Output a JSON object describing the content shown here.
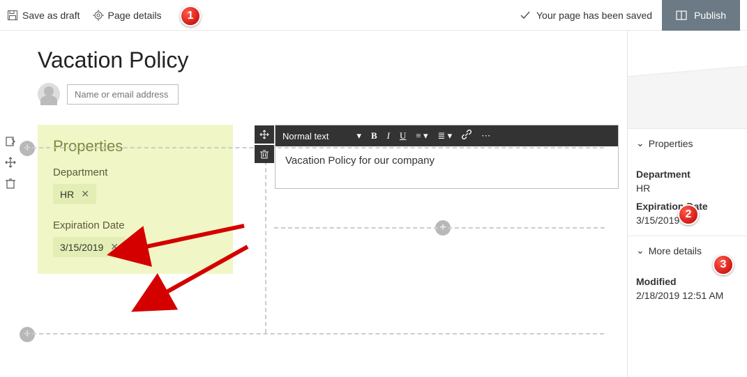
{
  "topbar": {
    "save_draft": "Save as draft",
    "page_details": "Page details",
    "saved_msg": "Your page has been saved",
    "publish": "Publish"
  },
  "page": {
    "title": "Vacation Policy",
    "name_placeholder": "Name or email address"
  },
  "editor": {
    "style_label": "Normal text",
    "body": "Vacation Policy for our company"
  },
  "left_card": {
    "heading": "Properties",
    "fields": [
      {
        "label": "Department",
        "value": "HR"
      },
      {
        "label": "Expiration Date",
        "value": "3/15/2019"
      }
    ]
  },
  "right_pane": {
    "properties_header": "Properties",
    "more_details_header": "More details",
    "department_label": "Department",
    "department_value": "HR",
    "expiration_label": "Expiration Date",
    "expiration_value": "3/15/2019",
    "modified_label": "Modified",
    "modified_value": "2/18/2019 12:51 AM"
  },
  "callouts": {
    "c1": "1",
    "c2": "2",
    "c3": "3"
  }
}
